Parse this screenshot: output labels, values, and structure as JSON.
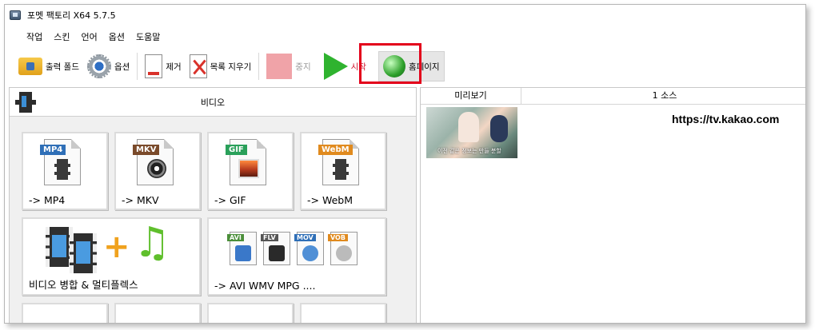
{
  "titlebar": {
    "title": "포멧 팩토리 X64 5.7.5"
  },
  "menu": [
    "작업",
    "스킨",
    "언어",
    "옵션",
    "도움말"
  ],
  "toolbar": {
    "output_folder": "출력 폴드",
    "options": "옵션",
    "remove": "제거",
    "clear_list": "목록 지우기",
    "stop": "중지",
    "start": "시작",
    "homepage": "홈페이지"
  },
  "left": {
    "category": "비디오",
    "tiles": [
      {
        "label": "-> MP4",
        "tag": "MP4",
        "tag_color": "#2f6fb7"
      },
      {
        "label": "-> MKV",
        "tag": "MKV",
        "tag_color": "#7a4a2a"
      },
      {
        "label": "-> GIF",
        "tag": "GIF",
        "tag_color": "#2aa05a"
      },
      {
        "label": "-> WebM",
        "tag": "WebM",
        "tag_color": "#e08a1e"
      },
      {
        "label": "비디오 병합 & 멀티플렉스"
      },
      {
        "label": "-> AVI WMV MPG ....",
        "mini_tags": [
          "AVI",
          "FLV",
          "MOV",
          "VOB"
        ]
      }
    ]
  },
  "right": {
    "columns": [
      "미리보기",
      "1 소스"
    ],
    "rows": [
      {
        "source": "https://tv.kakao.com",
        "thumb_caption": "이전 같은 정보는 만들 분할"
      }
    ]
  },
  "colors": {
    "highlight": "#e3001b",
    "play": "#2fb32f",
    "stop": "#f0a3a8"
  }
}
